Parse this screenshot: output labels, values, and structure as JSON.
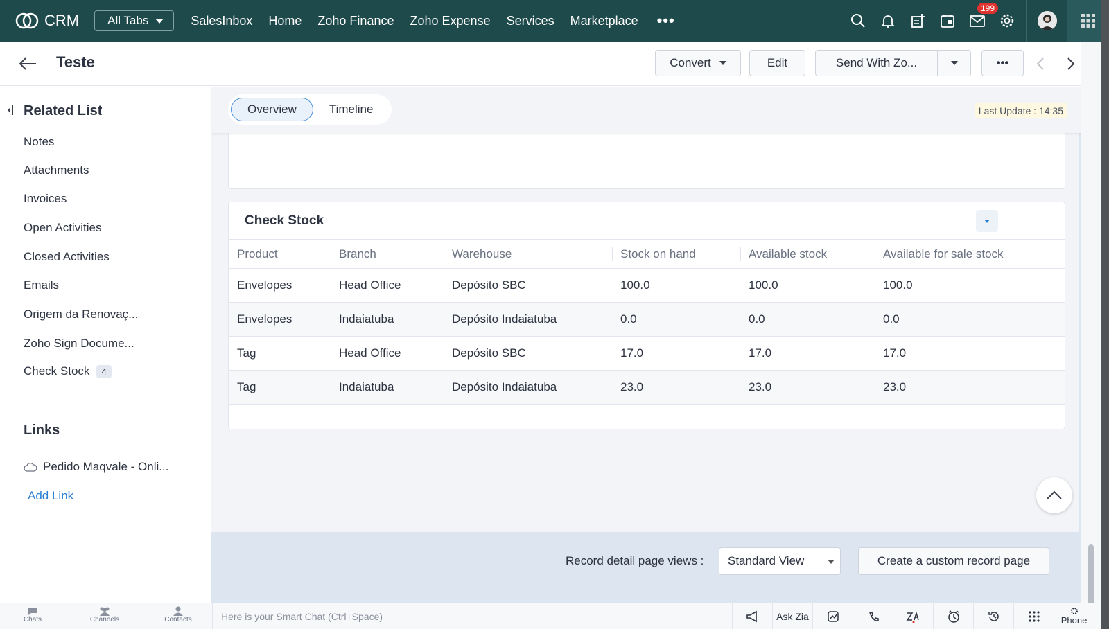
{
  "app": {
    "name": "CRM",
    "all_tabs": "All Tabs"
  },
  "nav": {
    "links": [
      "SalesInbox",
      "Home",
      "Zoho Finance",
      "Zoho Expense",
      "Services",
      "Marketplace"
    ],
    "more": "•••",
    "mail_badge": "199",
    "icons": [
      "search-icon",
      "bell-icon",
      "add-task-icon",
      "calendar-icon",
      "mail-icon",
      "gear-icon"
    ]
  },
  "record": {
    "title": "Teste",
    "convert_label": "Convert",
    "edit_label": "Edit",
    "send_label": "Send With Zo...",
    "more_label": "•••"
  },
  "related": {
    "heading": "Related List",
    "items": [
      {
        "label": "Notes",
        "count": ""
      },
      {
        "label": "Attachments",
        "count": ""
      },
      {
        "label": "Invoices",
        "count": ""
      },
      {
        "label": "Open Activities",
        "count": ""
      },
      {
        "label": "Closed Activities",
        "count": ""
      },
      {
        "label": "Emails",
        "count": ""
      },
      {
        "label": "Origem da Renovaç...",
        "count": ""
      },
      {
        "label": "Zoho Sign Docume...",
        "count": ""
      },
      {
        "label": "Check Stock",
        "count": "4"
      }
    ],
    "links_heading": "Links",
    "link_item": "Pedido Maqvale - Onli...",
    "add_link": "Add Link"
  },
  "tabs": {
    "overview": "Overview",
    "timeline": "Timeline"
  },
  "last_update": "Last Update : 14:35",
  "check_stock": {
    "title": "Check Stock",
    "columns": [
      "Product",
      "Branch",
      "Warehouse",
      "Stock on hand",
      "Available stock",
      "Available for sale stock"
    ],
    "rows": [
      [
        "Envelopes",
        "Head Office",
        "Depósito SBC",
        "100.0",
        "100.0",
        "100.0"
      ],
      [
        "Envelopes",
        "Indaiatuba",
        "Depósito Indaiatuba",
        "0.0",
        "0.0",
        "0.0"
      ],
      [
        "Tag",
        "Head Office",
        "Depósito SBC",
        "17.0",
        "17.0",
        "17.0"
      ],
      [
        "Tag",
        "Indaiatuba",
        "Depósito Indaiatuba",
        "23.0",
        "23.0",
        "23.0"
      ]
    ]
  },
  "footer_views": {
    "label": "Record detail page views :",
    "selected": "Standard View",
    "custom_button": "Create a custom record page"
  },
  "bottombar": {
    "tabs": [
      "Chats",
      "Channels",
      "Contacts"
    ],
    "smartchat_placeholder": "Here is your Smart Chat (Ctrl+Space)",
    "ask_zia": "Ask Zia",
    "phone": "Phone"
  },
  "colors": {
    "nav_bg": "#1f4a4c",
    "accent": "#2a7fd4",
    "badge": "#e0322e"
  }
}
